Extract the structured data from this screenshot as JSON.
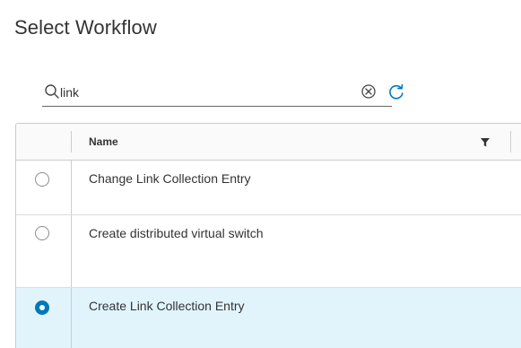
{
  "page": {
    "title": "Select Workflow"
  },
  "search": {
    "value": "link",
    "placeholder": ""
  },
  "grid": {
    "columns": [
      {
        "label": "Name"
      }
    ],
    "rows": [
      {
        "name": "Change Link Collection Entry",
        "selected": false
      },
      {
        "name": "Create distributed virtual switch",
        "selected": false
      },
      {
        "name": "Create Link Collection Entry",
        "selected": true
      }
    ]
  },
  "icons": {
    "search": "search-icon",
    "clear": "clear-icon",
    "refresh": "refresh-icon",
    "filter": "filter-icon"
  },
  "colors": {
    "accent": "#0079b8",
    "selected_row": "#e1f4fc",
    "refresh": "#0079b8"
  }
}
